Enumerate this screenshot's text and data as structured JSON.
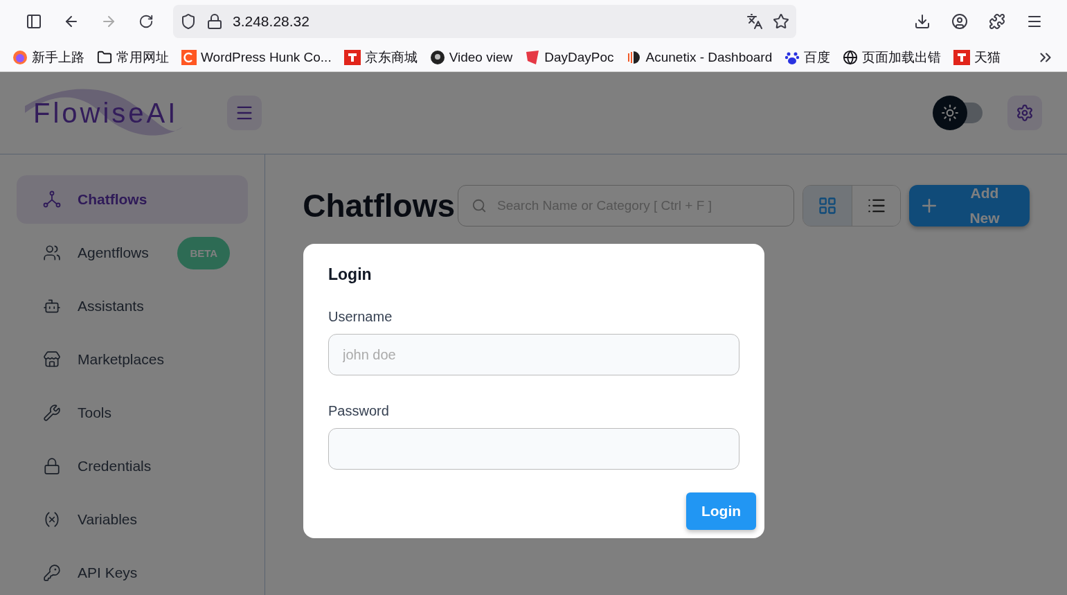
{
  "browser": {
    "address": "3.248.28.32",
    "bookmarks": [
      {
        "kind": "firefox",
        "label": "新手上路"
      },
      {
        "kind": "folder",
        "label": "常用网址"
      },
      {
        "kind": "orange-square",
        "label": "WordPress Hunk Co..."
      },
      {
        "kind": "red-square",
        "label": "京东商城"
      },
      {
        "kind": "disc",
        "label": "Video view"
      },
      {
        "kind": "shield",
        "label": "DayDayPoc"
      },
      {
        "kind": "stripes",
        "label": "Acunetix - Dashboard"
      },
      {
        "kind": "paw",
        "label": "百度"
      },
      {
        "kind": "globe",
        "label": "页面加载出错"
      },
      {
        "kind": "red-square",
        "label": "天猫"
      }
    ]
  },
  "app": {
    "logo": "FlowiseAI",
    "dark_mode": false,
    "sidebar": [
      {
        "label": "Chatflows",
        "selected": true
      },
      {
        "label": "Agentflows",
        "selected": false,
        "badge": "BETA"
      },
      {
        "label": "Assistants",
        "selected": false
      },
      {
        "label": "Marketplaces",
        "selected": false
      },
      {
        "label": "Tools",
        "selected": false
      },
      {
        "label": "Credentials",
        "selected": false
      },
      {
        "label": "Variables",
        "selected": false
      },
      {
        "label": "API Keys",
        "selected": false
      }
    ],
    "title": "Chatflows",
    "search": {
      "placeholder": "Search Name or Category [ Ctrl + F ]"
    },
    "views": [
      {
        "kind": "grid",
        "selected": true
      },
      {
        "kind": "list",
        "selected": false
      }
    ],
    "add_button": "Add New"
  },
  "dialog": {
    "title": "Login",
    "fields": [
      {
        "label": "Username",
        "placeholder": "john doe"
      },
      {
        "label": "Password"
      }
    ],
    "button": "Login"
  }
}
